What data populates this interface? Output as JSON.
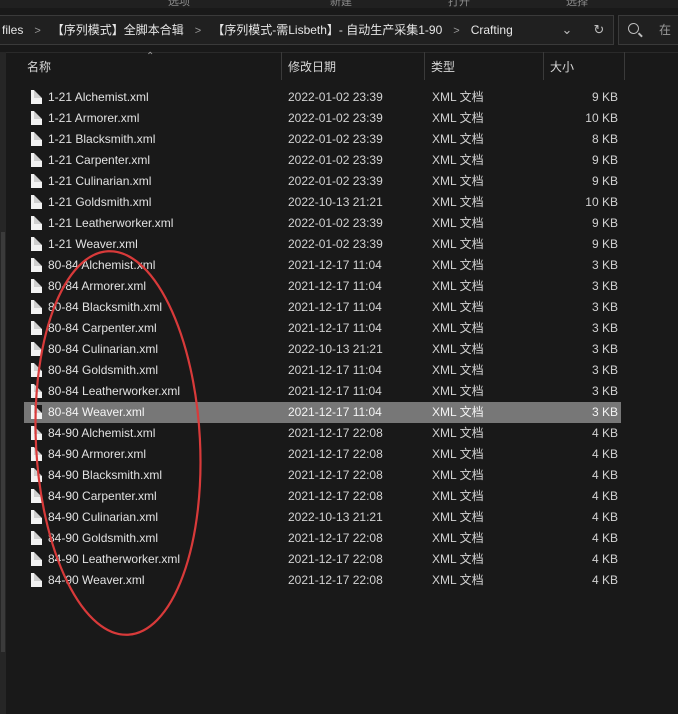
{
  "ribbon": {
    "labels": [
      "选项",
      "新建",
      "打开",
      "选择"
    ]
  },
  "address": {
    "crumbs": [
      "files",
      "【序列模式】全脚本合辑",
      "【序列模式-需Lisbeth】- 自动生产采集1-90",
      "Crafting"
    ],
    "dropdown_icon": "chevron-down-icon",
    "refresh_icon": "refresh-icon"
  },
  "search": {
    "placeholder": "在"
  },
  "columns": {
    "name": "名称",
    "date": "修改日期",
    "type": "类型",
    "size": "大小"
  },
  "annotation": {
    "shape": "red-ellipse",
    "color": "#d83a3a"
  },
  "files": [
    {
      "name": "1-21 Alchemist.xml",
      "date": "2022-01-02 23:39",
      "type": "XML 文档",
      "size": "9 KB"
    },
    {
      "name": "1-21 Armorer.xml",
      "date": "2022-01-02 23:39",
      "type": "XML 文档",
      "size": "10 KB"
    },
    {
      "name": "1-21 Blacksmith.xml",
      "date": "2022-01-02 23:39",
      "type": "XML 文档",
      "size": "8 KB"
    },
    {
      "name": "1-21 Carpenter.xml",
      "date": "2022-01-02 23:39",
      "type": "XML 文档",
      "size": "9 KB"
    },
    {
      "name": "1-21 Culinarian.xml",
      "date": "2022-01-02 23:39",
      "type": "XML 文档",
      "size": "9 KB"
    },
    {
      "name": "1-21 Goldsmith.xml",
      "date": "2022-10-13 21:21",
      "type": "XML 文档",
      "size": "10 KB"
    },
    {
      "name": "1-21 Leatherworker.xml",
      "date": "2022-01-02 23:39",
      "type": "XML 文档",
      "size": "9 KB"
    },
    {
      "name": "1-21 Weaver.xml",
      "date": "2022-01-02 23:39",
      "type": "XML 文档",
      "size": "9 KB"
    },
    {
      "name": "80-84 Alchemist.xml",
      "date": "2021-12-17 11:04",
      "type": "XML 文档",
      "size": "3 KB"
    },
    {
      "name": "80-84 Armorer.xml",
      "date": "2021-12-17 11:04",
      "type": "XML 文档",
      "size": "3 KB"
    },
    {
      "name": "80-84 Blacksmith.xml",
      "date": "2021-12-17 11:04",
      "type": "XML 文档",
      "size": "3 KB"
    },
    {
      "name": "80-84 Carpenter.xml",
      "date": "2021-12-17 11:04",
      "type": "XML 文档",
      "size": "3 KB"
    },
    {
      "name": "80-84 Culinarian.xml",
      "date": "2022-10-13 21:21",
      "type": "XML 文档",
      "size": "3 KB"
    },
    {
      "name": "80-84 Goldsmith.xml",
      "date": "2021-12-17 11:04",
      "type": "XML 文档",
      "size": "3 KB"
    },
    {
      "name": "80-84 Leatherworker.xml",
      "date": "2021-12-17 11:04",
      "type": "XML 文档",
      "size": "3 KB"
    },
    {
      "name": "80-84 Weaver.xml",
      "date": "2021-12-17 11:04",
      "type": "XML 文档",
      "size": "3 KB",
      "selected": true
    },
    {
      "name": "84-90 Alchemist.xml",
      "date": "2021-12-17 22:08",
      "type": "XML 文档",
      "size": "4 KB"
    },
    {
      "name": "84-90 Armorer.xml",
      "date": "2021-12-17 22:08",
      "type": "XML 文档",
      "size": "4 KB"
    },
    {
      "name": "84-90 Blacksmith.xml",
      "date": "2021-12-17 22:08",
      "type": "XML 文档",
      "size": "4 KB"
    },
    {
      "name": "84-90 Carpenter.xml",
      "date": "2021-12-17 22:08",
      "type": "XML 文档",
      "size": "4 KB"
    },
    {
      "name": "84-90 Culinarian.xml",
      "date": "2022-10-13 21:21",
      "type": "XML 文档",
      "size": "4 KB"
    },
    {
      "name": "84-90 Goldsmith.xml",
      "date": "2021-12-17 22:08",
      "type": "XML 文档",
      "size": "4 KB"
    },
    {
      "name": "84-90 Leatherworker.xml",
      "date": "2021-12-17 22:08",
      "type": "XML 文档",
      "size": "4 KB"
    },
    {
      "name": "84-90 Weaver.xml",
      "date": "2021-12-17 22:08",
      "type": "XML 文档",
      "size": "4 KB"
    }
  ]
}
